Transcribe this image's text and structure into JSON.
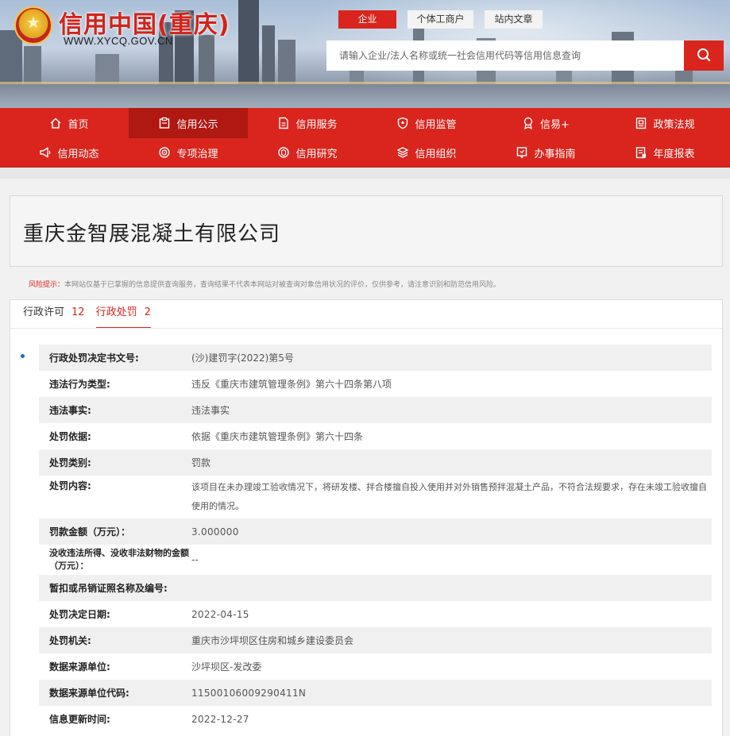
{
  "header": {
    "site_title": "信用中国(重庆)",
    "site_url": "WWW.XYCQ.GOV.CN",
    "search_tabs": [
      {
        "label": "企业",
        "active": true
      },
      {
        "label": "个体工商户",
        "active": false
      },
      {
        "label": "站内文章",
        "active": false
      }
    ],
    "search_placeholder": "请输入企业/法人名称或统一社会信用代码等信用信息查询",
    "search_icon": "search-icon"
  },
  "nav": {
    "row1": [
      {
        "label": "首页",
        "icon": "home-icon"
      },
      {
        "label": "信用公示",
        "icon": "clipboard-icon",
        "active": true
      },
      {
        "label": "信用服务",
        "icon": "document-icon"
      },
      {
        "label": "信用监管",
        "icon": "shield-icon"
      },
      {
        "label": "信易+",
        "icon": "award-icon"
      },
      {
        "label": "政策法规",
        "icon": "policy-icon"
      }
    ],
    "row2": [
      {
        "label": "信用动态",
        "icon": "megaphone-icon"
      },
      {
        "label": "专项治理",
        "icon": "target-icon"
      },
      {
        "label": "信用研究",
        "icon": "research-icon"
      },
      {
        "label": "信用组织",
        "icon": "layers-icon"
      },
      {
        "label": "办事指南",
        "icon": "guide-icon"
      },
      {
        "label": "年度报表",
        "icon": "report-icon"
      }
    ]
  },
  "company": {
    "name": "重庆金智展混凝土有限公司"
  },
  "risk_notice": {
    "label": "风险提示：",
    "text": "本网站仅基于已掌握的信息提供查询服务，查询结果不代表本网站对被查询对象信用状况的评价，仅供参考，请注意识别和防范信用风险。"
  },
  "tabs": [
    {
      "label": "行政许可",
      "count": "12",
      "active": false
    },
    {
      "label": "行政处罚",
      "count": "2",
      "active": true
    }
  ],
  "record": {
    "fields": [
      {
        "key": "行政处罚决定书文号:",
        "value": "(沙)建罚字(2022)第5号"
      },
      {
        "key": "违法行为类型:",
        "value": "违反《重庆市建筑管理条例》第六十四条第八项"
      },
      {
        "key": "违法事实:",
        "value": "违法事实"
      },
      {
        "key": "处罚依据:",
        "value": "依据《重庆市建筑管理条例》第六十四条"
      },
      {
        "key": "处罚类别:",
        "value": "罚款"
      },
      {
        "key": "处罚内容:",
        "value": "该项目在未办理竣工验收情况下，将研发楼、拌合楼擅自投入使用并对外销售预拌混凝土产品，不符合法规要求，存在未竣工验收擅自使用的情况。"
      },
      {
        "key": "罚款金额（万元）：",
        "value": "3.000000"
      },
      {
        "key": "没收违法所得、没收非法财物的金额（万元）：",
        "value": "--"
      },
      {
        "key": "暂扣或吊销证照名称及编号:",
        "value": ""
      },
      {
        "key": "处罚决定日期:",
        "value": "2022-04-15"
      },
      {
        "key": "处罚机关:",
        "value": "重庆市沙坪坝区住房和城乡建设委员会"
      },
      {
        "key": "数据来源单位:",
        "value": "沙坪坝区-发改委"
      },
      {
        "key": "数据来源单位代码:",
        "value": "11500106009290411N"
      },
      {
        "key": "信息更新时间:",
        "value": "2022-12-27"
      }
    ]
  }
}
